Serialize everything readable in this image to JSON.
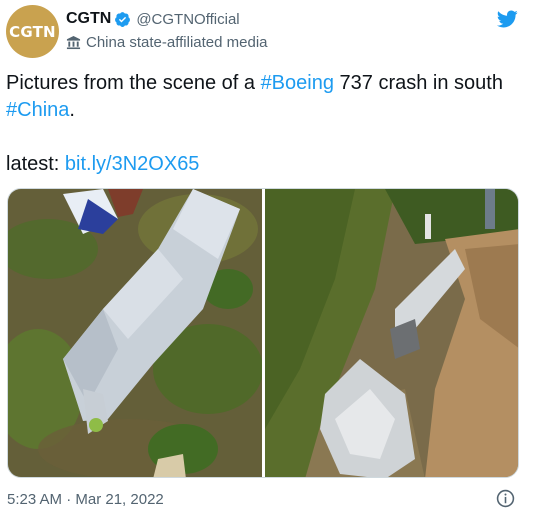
{
  "account": {
    "avatar_text": "CGTN",
    "display_name": "CGTN",
    "handle": "@CGTNOfficial",
    "label": "China state-affiliated media"
  },
  "tweet": {
    "text_part1": "Pictures from the scene of a ",
    "hashtag1": "#Boeing",
    "text_part2": " 737 crash in south ",
    "hashtag2": "#China",
    "text_part3": ".",
    "latest_label": "latest: ",
    "link": "bit.ly/3N2OX65"
  },
  "footer": {
    "timestamp": "5:23 AM · Mar 21, 2022"
  },
  "colors": {
    "accent": "#1d9bf0",
    "avatar_bg": "#c9a24f",
    "secondary_text": "#536471"
  },
  "icons": {
    "verified": "verified-badge-icon",
    "affiliation": "government-building-icon",
    "brand": "twitter-bird-icon",
    "info": "info-circle-icon"
  }
}
